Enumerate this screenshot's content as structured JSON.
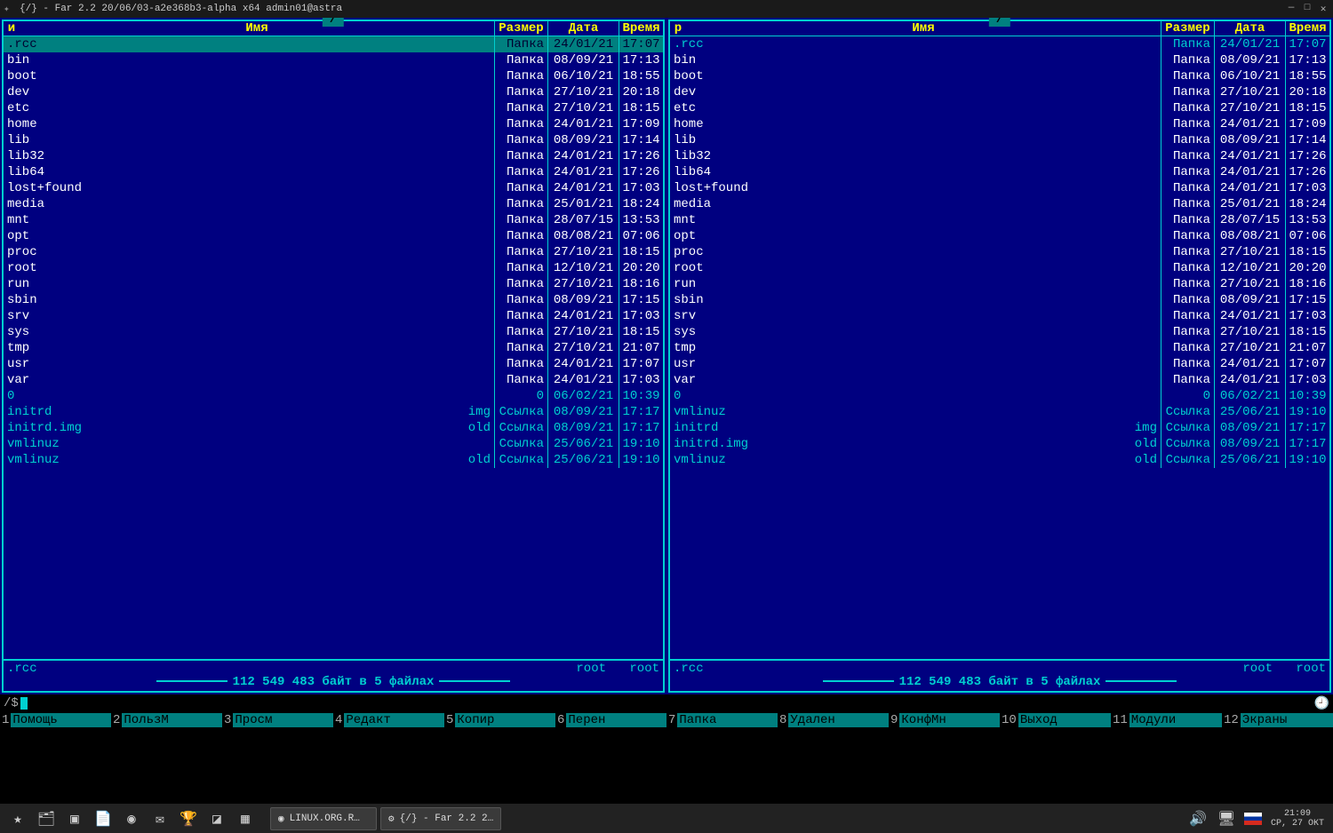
{
  "window": {
    "title": "{/} - Far 2.2 20/06/03-a2e368b3-alpha x64 admin01@astra"
  },
  "panels": {
    "left": {
      "path": "/",
      "sort_indicator": "и",
      "headers": {
        "name": "Имя",
        "size": "Размер",
        "date": "Дата",
        "time": "Время"
      },
      "items": [
        {
          "name": ".rcc",
          "ext": "",
          "size": "Папка",
          "date": "24/01/21",
          "time": "17:07",
          "type": "dir",
          "selected": true
        },
        {
          "name": "bin",
          "ext": "",
          "size": "Папка",
          "date": "08/09/21",
          "time": "17:13",
          "type": "dir"
        },
        {
          "name": "boot",
          "ext": "",
          "size": "Папка",
          "date": "06/10/21",
          "time": "18:55",
          "type": "dir"
        },
        {
          "name": "dev",
          "ext": "",
          "size": "Папка",
          "date": "27/10/21",
          "time": "20:18",
          "type": "dir"
        },
        {
          "name": "etc",
          "ext": "",
          "size": "Папка",
          "date": "27/10/21",
          "time": "18:15",
          "type": "dir"
        },
        {
          "name": "home",
          "ext": "",
          "size": "Папка",
          "date": "24/01/21",
          "time": "17:09",
          "type": "dir"
        },
        {
          "name": "lib",
          "ext": "",
          "size": "Папка",
          "date": "08/09/21",
          "time": "17:14",
          "type": "dir"
        },
        {
          "name": "lib32",
          "ext": "",
          "size": "Папка",
          "date": "24/01/21",
          "time": "17:26",
          "type": "dir"
        },
        {
          "name": "lib64",
          "ext": "",
          "size": "Папка",
          "date": "24/01/21",
          "time": "17:26",
          "type": "dir"
        },
        {
          "name": "lost+found",
          "ext": "",
          "size": "Папка",
          "date": "24/01/21",
          "time": "17:03",
          "type": "dir"
        },
        {
          "name": "media",
          "ext": "",
          "size": "Папка",
          "date": "25/01/21",
          "time": "18:24",
          "type": "dir"
        },
        {
          "name": "mnt",
          "ext": "",
          "size": "Папка",
          "date": "28/07/15",
          "time": "13:53",
          "type": "dir"
        },
        {
          "name": "opt",
          "ext": "",
          "size": "Папка",
          "date": "08/08/21",
          "time": "07:06",
          "type": "dir"
        },
        {
          "name": "proc",
          "ext": "",
          "size": "Папка",
          "date": "27/10/21",
          "time": "18:15",
          "type": "dir"
        },
        {
          "name": "root",
          "ext": "",
          "size": "Папка",
          "date": "12/10/21",
          "time": "20:20",
          "type": "dir"
        },
        {
          "name": "run",
          "ext": "",
          "size": "Папка",
          "date": "27/10/21",
          "time": "18:16",
          "type": "dir"
        },
        {
          "name": "sbin",
          "ext": "",
          "size": "Папка",
          "date": "08/09/21",
          "time": "17:15",
          "type": "dir"
        },
        {
          "name": "srv",
          "ext": "",
          "size": "Папка",
          "date": "24/01/21",
          "time": "17:03",
          "type": "dir"
        },
        {
          "name": "sys",
          "ext": "",
          "size": "Папка",
          "date": "27/10/21",
          "time": "18:15",
          "type": "dir"
        },
        {
          "name": "tmp",
          "ext": "",
          "size": "Папка",
          "date": "27/10/21",
          "time": "21:07",
          "type": "dir"
        },
        {
          "name": "usr",
          "ext": "",
          "size": "Папка",
          "date": "24/01/21",
          "time": "17:07",
          "type": "dir"
        },
        {
          "name": "var",
          "ext": "",
          "size": "Папка",
          "date": "24/01/21",
          "time": "17:03",
          "type": "dir"
        },
        {
          "name": "0",
          "ext": "",
          "size": "0",
          "date": "06/02/21",
          "time": "10:39",
          "type": "file"
        },
        {
          "name": "initrd",
          "ext": "img",
          "size": "Ссылка",
          "date": "08/09/21",
          "time": "17:17",
          "type": "link"
        },
        {
          "name": "initrd.img",
          "ext": "old",
          "size": "Ссылка",
          "date": "08/09/21",
          "time": "17:17",
          "type": "link"
        },
        {
          "name": "vmlinuz",
          "ext": "",
          "size": "Ссылка",
          "date": "25/06/21",
          "time": "19:10",
          "type": "link"
        },
        {
          "name": "vmlinuz",
          "ext": "old",
          "size": "Ссылка",
          "date": "25/06/21",
          "time": "19:10",
          "type": "link"
        }
      ],
      "status": {
        "current": ".rcc",
        "owner1": "root",
        "owner2": "root"
      },
      "summary": "112 549 483 байт в 5 файлах"
    },
    "right": {
      "path": "/",
      "sort_indicator": "р",
      "headers": {
        "name": "Имя",
        "size": "Размер",
        "date": "Дата",
        "time": "Время"
      },
      "items": [
        {
          "name": ".rcc",
          "ext": "",
          "size": "Папка",
          "date": "24/01/21",
          "time": "17:07",
          "type": "link"
        },
        {
          "name": "bin",
          "ext": "",
          "size": "Папка",
          "date": "08/09/21",
          "time": "17:13",
          "type": "dir"
        },
        {
          "name": "boot",
          "ext": "",
          "size": "Папка",
          "date": "06/10/21",
          "time": "18:55",
          "type": "dir"
        },
        {
          "name": "dev",
          "ext": "",
          "size": "Папка",
          "date": "27/10/21",
          "time": "20:18",
          "type": "dir"
        },
        {
          "name": "etc",
          "ext": "",
          "size": "Папка",
          "date": "27/10/21",
          "time": "18:15",
          "type": "dir"
        },
        {
          "name": "home",
          "ext": "",
          "size": "Папка",
          "date": "24/01/21",
          "time": "17:09",
          "type": "dir"
        },
        {
          "name": "lib",
          "ext": "",
          "size": "Папка",
          "date": "08/09/21",
          "time": "17:14",
          "type": "dir"
        },
        {
          "name": "lib32",
          "ext": "",
          "size": "Папка",
          "date": "24/01/21",
          "time": "17:26",
          "type": "dir"
        },
        {
          "name": "lib64",
          "ext": "",
          "size": "Папка",
          "date": "24/01/21",
          "time": "17:26",
          "type": "dir"
        },
        {
          "name": "lost+found",
          "ext": "",
          "size": "Папка",
          "date": "24/01/21",
          "time": "17:03",
          "type": "dir"
        },
        {
          "name": "media",
          "ext": "",
          "size": "Папка",
          "date": "25/01/21",
          "time": "18:24",
          "type": "dir"
        },
        {
          "name": "mnt",
          "ext": "",
          "size": "Папка",
          "date": "28/07/15",
          "time": "13:53",
          "type": "dir"
        },
        {
          "name": "opt",
          "ext": "",
          "size": "Папка",
          "date": "08/08/21",
          "time": "07:06",
          "type": "dir"
        },
        {
          "name": "proc",
          "ext": "",
          "size": "Папка",
          "date": "27/10/21",
          "time": "18:15",
          "type": "dir"
        },
        {
          "name": "root",
          "ext": "",
          "size": "Папка",
          "date": "12/10/21",
          "time": "20:20",
          "type": "dir"
        },
        {
          "name": "run",
          "ext": "",
          "size": "Папка",
          "date": "27/10/21",
          "time": "18:16",
          "type": "dir"
        },
        {
          "name": "sbin",
          "ext": "",
          "size": "Папка",
          "date": "08/09/21",
          "time": "17:15",
          "type": "dir"
        },
        {
          "name": "srv",
          "ext": "",
          "size": "Папка",
          "date": "24/01/21",
          "time": "17:03",
          "type": "dir"
        },
        {
          "name": "sys",
          "ext": "",
          "size": "Папка",
          "date": "27/10/21",
          "time": "18:15",
          "type": "dir"
        },
        {
          "name": "tmp",
          "ext": "",
          "size": "Папка",
          "date": "27/10/21",
          "time": "21:07",
          "type": "dir"
        },
        {
          "name": "usr",
          "ext": "",
          "size": "Папка",
          "date": "24/01/21",
          "time": "17:07",
          "type": "dir"
        },
        {
          "name": "var",
          "ext": "",
          "size": "Папка",
          "date": "24/01/21",
          "time": "17:03",
          "type": "dir"
        },
        {
          "name": "0",
          "ext": "",
          "size": "0",
          "date": "06/02/21",
          "time": "10:39",
          "type": "file"
        },
        {
          "name": "vmlinuz",
          "ext": "",
          "size": "Ссылка",
          "date": "25/06/21",
          "time": "19:10",
          "type": "link"
        },
        {
          "name": "initrd",
          "ext": "img",
          "size": "Ссылка",
          "date": "08/09/21",
          "time": "17:17",
          "type": "link"
        },
        {
          "name": "initrd.img",
          "ext": "old",
          "size": "Ссылка",
          "date": "08/09/21",
          "time": "17:17",
          "type": "link"
        },
        {
          "name": "vmlinuz",
          "ext": "old",
          "size": "Ссылка",
          "date": "25/06/21",
          "time": "19:10",
          "type": "link"
        }
      ],
      "status": {
        "current": ".rcc",
        "owner1": "root",
        "owner2": "root"
      },
      "summary": "112 549 483 байт в 5 файлах"
    }
  },
  "cmdline": {
    "prompt": "/$"
  },
  "keybar": [
    {
      "n": "1",
      "l": "Помощь"
    },
    {
      "n": "2",
      "l": "ПользМ"
    },
    {
      "n": "3",
      "l": "Просм"
    },
    {
      "n": "4",
      "l": "Редакт"
    },
    {
      "n": "5",
      "l": "Копир"
    },
    {
      "n": "6",
      "l": "Перен"
    },
    {
      "n": "7",
      "l": "Папка"
    },
    {
      "n": "8",
      "l": "Удален"
    },
    {
      "n": "9",
      "l": "КонфМн"
    },
    {
      "n": "10",
      "l": "Выход"
    },
    {
      "n": "11",
      "l": "Модули"
    },
    {
      "n": "12",
      "l": "Экраны"
    }
  ],
  "taskbar": {
    "tasks": [
      {
        "icon": "●",
        "label": "LINUX.ORG.R…"
      },
      {
        "icon": "⚙",
        "label": "{/} - Far 2.2 2…"
      }
    ],
    "clock": {
      "time": "21:09",
      "date": "СР, 27 ОКТ"
    }
  }
}
